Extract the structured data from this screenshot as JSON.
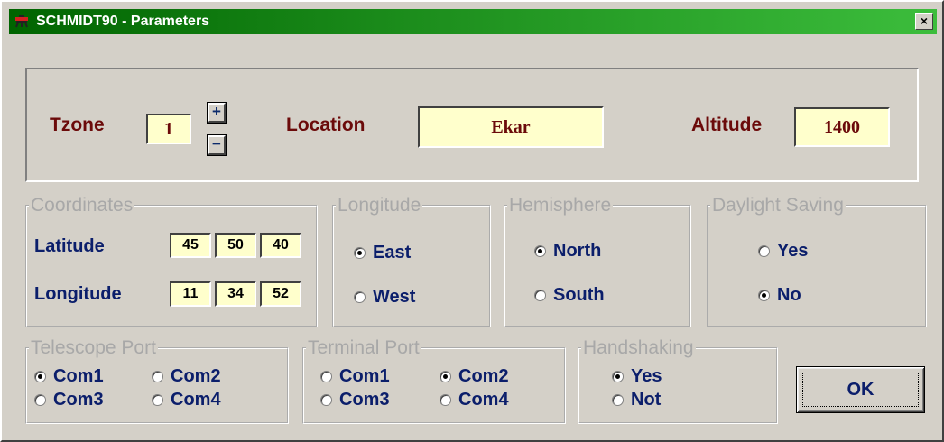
{
  "window": {
    "title": "SCHMIDT90 - Parameters",
    "close_symbol": "×"
  },
  "header": {
    "tzone": {
      "label": "Tzone",
      "value": "1",
      "plus": "+",
      "minus": "−"
    },
    "location": {
      "label": "Location",
      "value": "Ekar"
    },
    "altitude": {
      "label": "Altitude",
      "value": "1400"
    }
  },
  "coordinates": {
    "legend": "Coordinates",
    "latitude": {
      "label": "Latitude",
      "deg": "45",
      "min": "50",
      "sec": "40"
    },
    "longitude": {
      "label": "Longitude",
      "deg": "11",
      "min": "34",
      "sec": "52"
    }
  },
  "longitude_dir": {
    "legend": "Longitude",
    "options": [
      "East",
      "West"
    ],
    "selected": "East"
  },
  "hemisphere": {
    "legend": "Hemisphere",
    "options": [
      "North",
      "South"
    ],
    "selected": "North"
  },
  "daylight": {
    "legend": "Daylight Saving",
    "options": [
      "Yes",
      "No"
    ],
    "selected": "No"
  },
  "telescope_port": {
    "legend": "Telescope Port",
    "options": [
      "Com1",
      "Com2",
      "Com3",
      "Com4"
    ],
    "selected": "Com1"
  },
  "terminal_port": {
    "legend": "Terminal Port",
    "options": [
      "Com1",
      "Com2",
      "Com3",
      "Com4"
    ],
    "selected": "Com2"
  },
  "handshaking": {
    "legend": "Handshaking",
    "options": [
      "Yes",
      "Not"
    ],
    "selected": "Yes"
  },
  "ok_label": "OK",
  "colors": {
    "title_bar": "#1a8a1a",
    "field_bg": "#ffffcc",
    "label_maroon": "#6b0a0a",
    "label_blue": "#0b1e6b",
    "face": "#d4d0c8"
  },
  "icons": {
    "app": "telescope-icon",
    "close": "close-icon"
  }
}
